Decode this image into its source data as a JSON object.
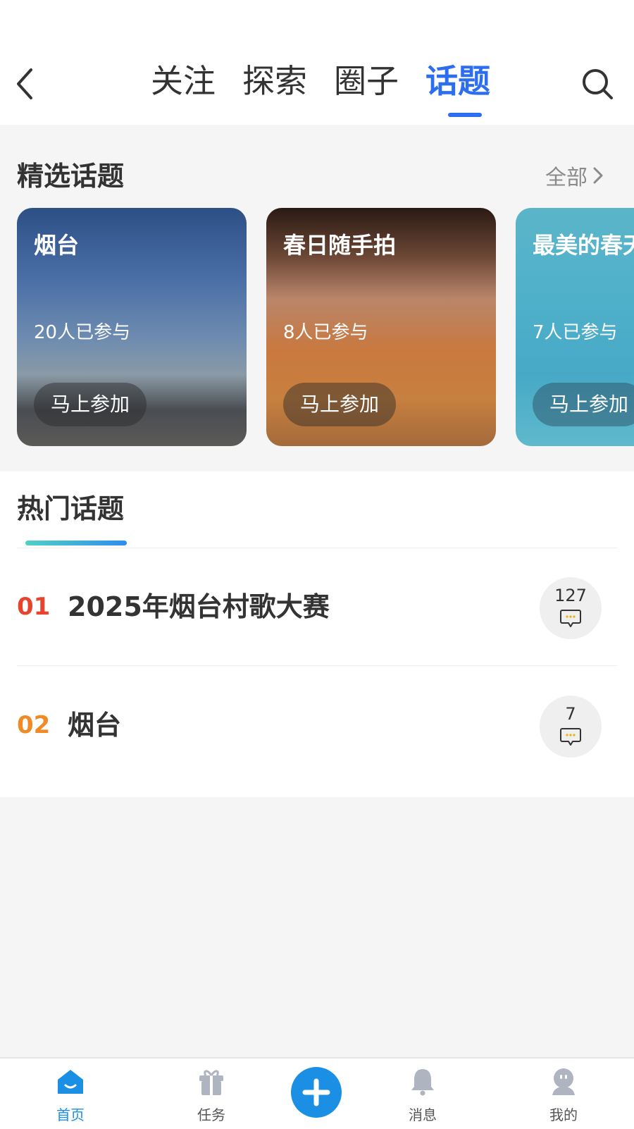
{
  "nav": {
    "tabs": [
      {
        "label": "关注"
      },
      {
        "label": "探索"
      },
      {
        "label": "圈子"
      },
      {
        "label": "话题",
        "active": true
      }
    ],
    "accent_color": "#2b6ff0"
  },
  "featured": {
    "title": "精选话题",
    "all_label": "全部",
    "cards": [
      {
        "title": "烟台",
        "count": "20人已参与",
        "button": "马上参加"
      },
      {
        "title": "春日随手拍",
        "count": "8人已参与",
        "button": "马上参加"
      },
      {
        "title": "最美的春天",
        "count": "7人已参与",
        "button": "马上参加"
      }
    ]
  },
  "hot": {
    "title": "热门话题",
    "items": [
      {
        "rank": "01",
        "name": "2025年烟台村歌大赛",
        "comments": "127",
        "rank_color": "#e8442d"
      },
      {
        "rank": "02",
        "name": "烟台",
        "comments": "7",
        "rank_color": "#f08a24"
      }
    ]
  },
  "tabbar": {
    "items": [
      {
        "label": "首页",
        "icon": "home-icon",
        "active": true
      },
      {
        "label": "任务",
        "icon": "gift-icon"
      },
      {
        "label": "",
        "icon": "plus-icon"
      },
      {
        "label": "消息",
        "icon": "bell-icon"
      },
      {
        "label": "我的",
        "icon": "profile-icon"
      }
    ],
    "active_color": "#1a8fe3"
  }
}
